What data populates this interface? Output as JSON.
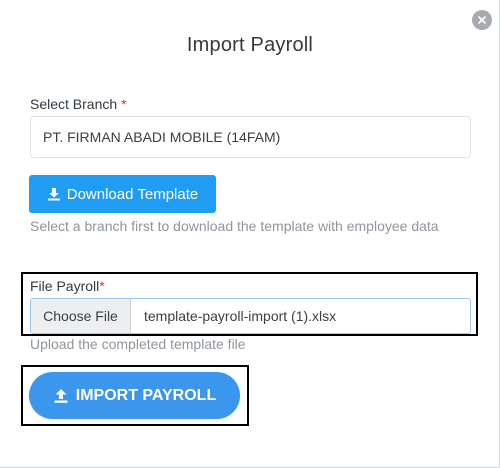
{
  "modal": {
    "title": "Import Payroll",
    "close_icon": "close-icon"
  },
  "branch": {
    "label": "Select Branch",
    "required_mark": "*",
    "selected_value": "PT. FIRMAN ABADI MOBILE (14FAM)"
  },
  "download": {
    "label": "Download Template",
    "icon": "download-icon",
    "hint": "Select a branch first to download the template with employee data"
  },
  "file": {
    "label": "File Payroll",
    "required_mark": "*",
    "choose_label": "Choose File",
    "file_name": "template-payroll-import (1).xlsx",
    "hint": "Upload the completed template file"
  },
  "import": {
    "label": "IMPORT PAYROLL",
    "icon": "upload-icon"
  },
  "colors": {
    "primary": "#1e9df2",
    "import_button": "#3b96ee",
    "required": "#e3342f",
    "hint_text": "#8e959c"
  }
}
